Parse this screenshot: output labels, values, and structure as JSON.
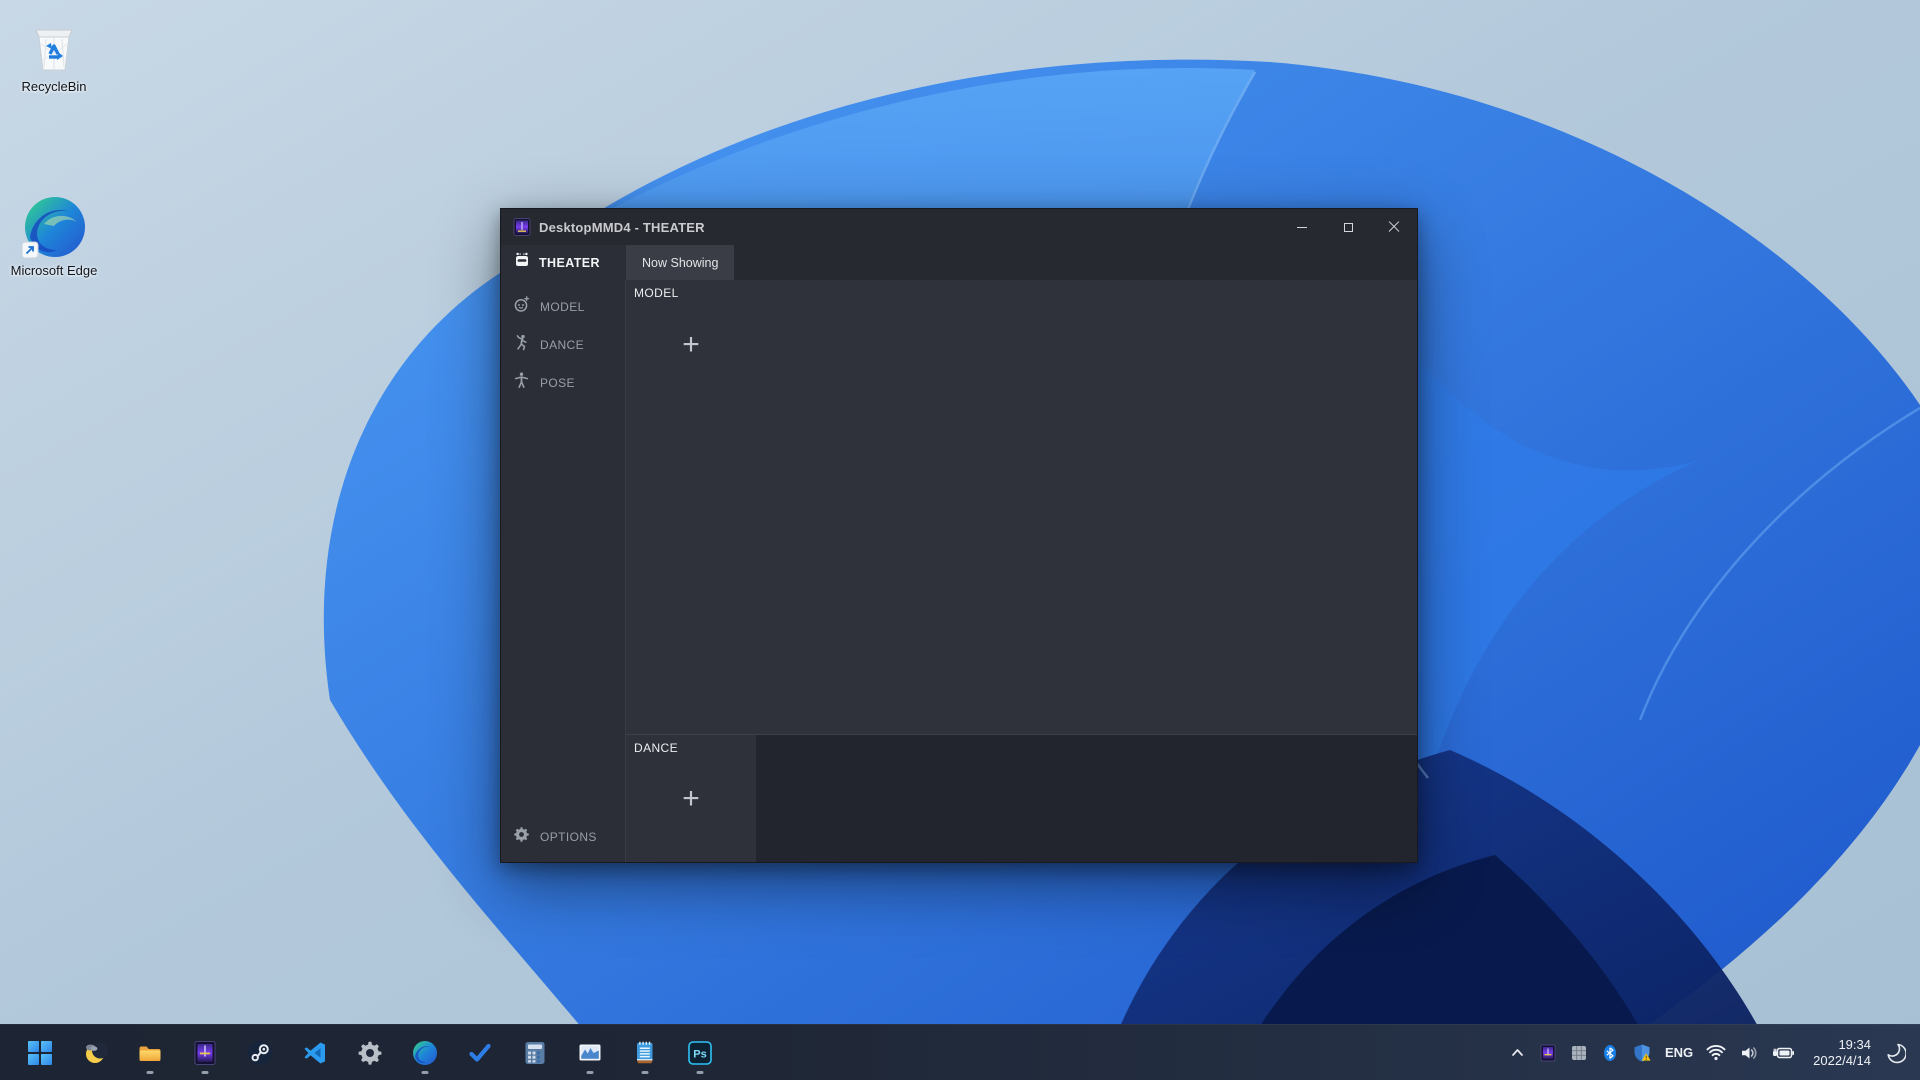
{
  "desktop": {
    "icons": [
      {
        "id": "recycle-bin",
        "label": "RecycleBin"
      },
      {
        "id": "microsoft-edge",
        "label": "Microsoft Edge"
      }
    ]
  },
  "window": {
    "title": "DesktopMMD4 - THEATER",
    "app_tab": "THEATER",
    "tabs": [
      {
        "label": "Now Showing",
        "active": true
      }
    ],
    "sidebar": {
      "items": [
        {
          "label": "MODEL",
          "icon": "model-face-icon"
        },
        {
          "label": "DANCE",
          "icon": "dancer-icon"
        },
        {
          "label": "POSE",
          "icon": "pose-figure-icon"
        }
      ],
      "options_label": "OPTIONS"
    },
    "content": {
      "model_panel": {
        "title": "MODEL",
        "add_button": "+"
      },
      "dance_panel": {
        "title": "DANCE",
        "add_button": "+"
      }
    }
  },
  "taskbar": {
    "apps": [
      {
        "name": "start",
        "running": false
      },
      {
        "name": "widgets-weather",
        "running": false
      },
      {
        "name": "file-explorer",
        "running": true
      },
      {
        "name": "desktopmmd",
        "running": true
      },
      {
        "name": "steam",
        "running": false
      },
      {
        "name": "vscode",
        "running": false
      },
      {
        "name": "settings",
        "running": false
      },
      {
        "name": "edge",
        "running": true
      },
      {
        "name": "todo-check",
        "running": false
      },
      {
        "name": "calculator",
        "running": false
      },
      {
        "name": "photos",
        "running": true
      },
      {
        "name": "notepad",
        "running": true
      },
      {
        "name": "photoshop",
        "running": true
      }
    ],
    "photoshop_label": "Ps",
    "tray": {
      "language": "ENG",
      "time": "19:34",
      "date": "2022/4/14"
    }
  },
  "colors": {
    "accent_blue": "#2f7de9",
    "window_bg": "#2f323b",
    "titlebar_bg": "#26292f",
    "sidebar_bg": "#2b2e37",
    "strip_bg": "#22252d",
    "taskbar_bg": "#1f2736"
  }
}
